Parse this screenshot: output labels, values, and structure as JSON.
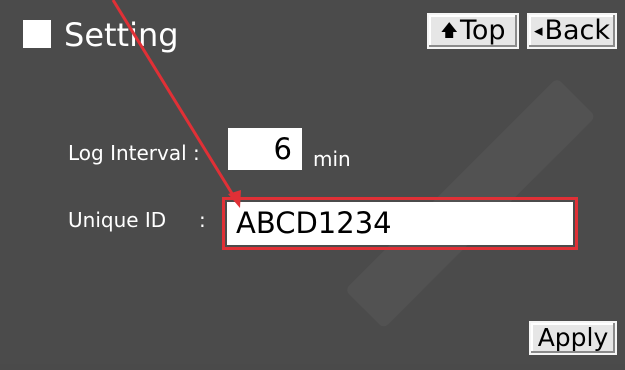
{
  "header": {
    "title": "Setting",
    "top_label": "Top",
    "back_label": "Back"
  },
  "form": {
    "log_interval_label": "Log Interval :",
    "log_interval_value": "6",
    "log_interval_unit": "min",
    "unique_id_label": "Unique ID",
    "unique_id_colon": ":",
    "unique_id_value": "ABCD1234"
  },
  "footer": {
    "apply_label": "Apply"
  },
  "colors": {
    "background": "#4b4b4b",
    "highlight": "#e03036",
    "arrow": "#e03036"
  },
  "icons": {
    "top": "up-arrow-icon",
    "back": "left-triangle-icon"
  }
}
